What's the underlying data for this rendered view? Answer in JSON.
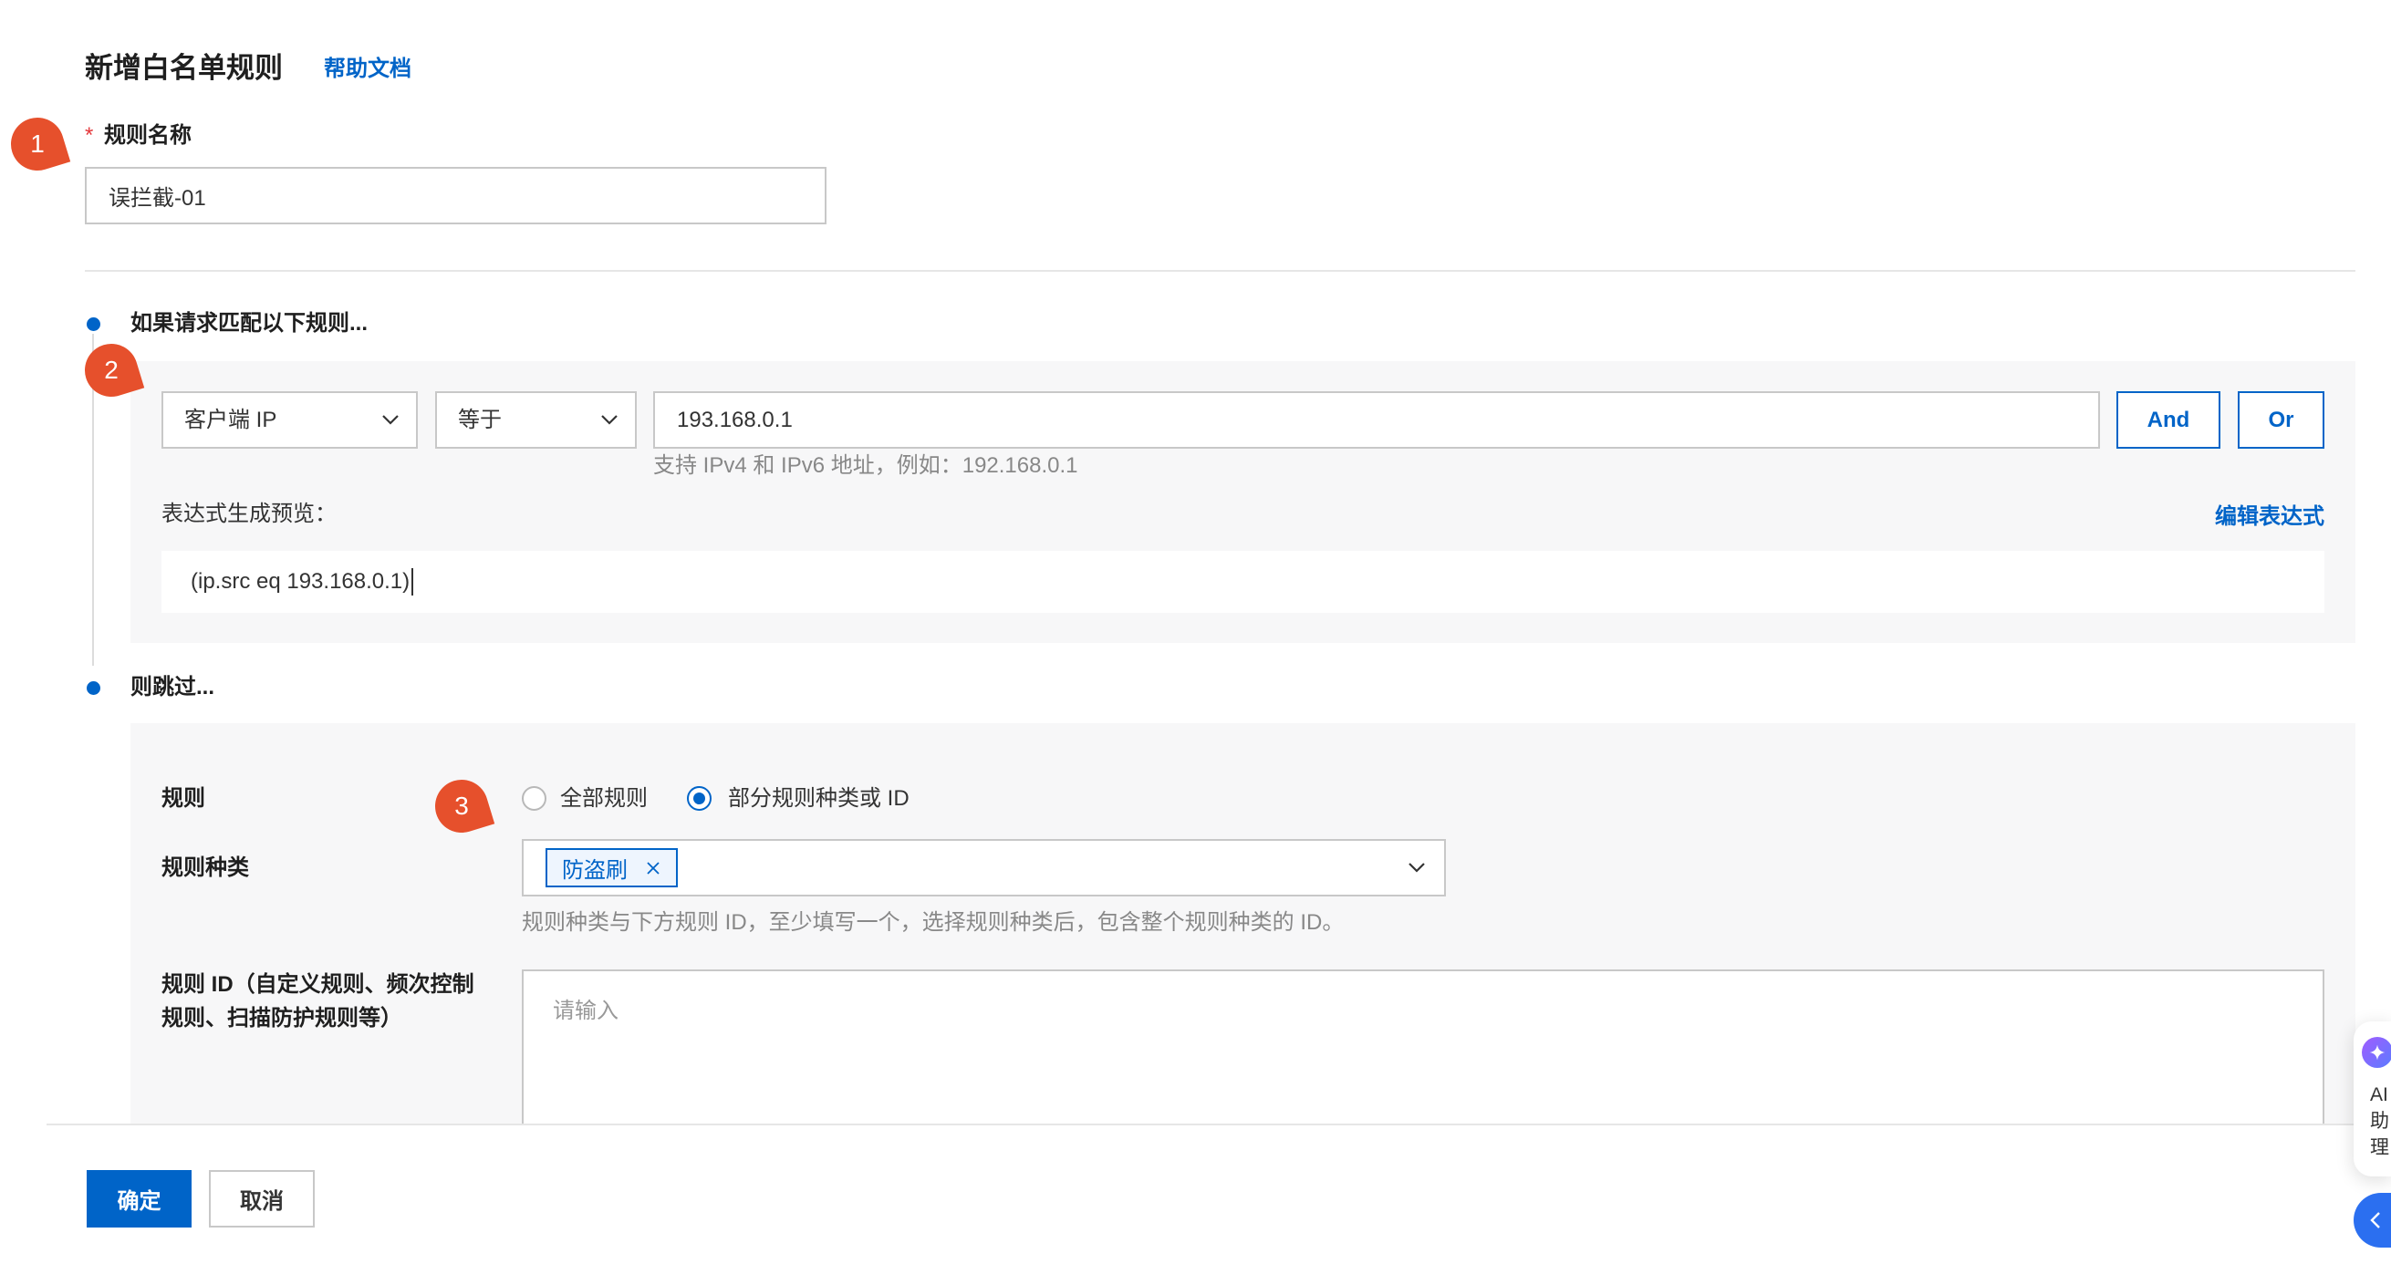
{
  "page": {
    "title": "新增白名单规则",
    "help_link": "帮助文档"
  },
  "annotation_markers": [
    "1",
    "2",
    "3"
  ],
  "rule_name": {
    "required_mark": "*",
    "label": "规则名称",
    "value": "误拦截-01"
  },
  "match_section": {
    "heading": "如果请求匹配以下规则...",
    "condition": {
      "field": "客户端 IP",
      "operator": "等于",
      "value": "193.168.0.1",
      "and_button": "And",
      "or_button": "Or",
      "hint": "支持 IPv4 和 IPv6 地址，例如：192.168.0.1"
    },
    "preview_label": "表达式生成预览：",
    "edit_expression_link": "编辑表达式",
    "expression": "(ip.src eq 193.168.0.1)"
  },
  "skip_section": {
    "heading": "则跳过...",
    "rules": {
      "label": "规则",
      "options": [
        {
          "label": "全部规则",
          "selected": false
        },
        {
          "label": "部分规则种类或 ID",
          "selected": true
        }
      ]
    },
    "rule_category": {
      "label": "规则种类",
      "selected_tags": [
        "防盗刷"
      ],
      "hint": "规则种类与下方规则 ID，至少填写一个，选择规则种类后，包含整个规则种类的 ID。"
    },
    "rule_ids": {
      "label_lines": [
        "规则 ID（自定义规则、频次控制",
        "规则、扫描防护规则等）"
      ],
      "placeholder": "请输入"
    }
  },
  "footer": {
    "confirm_button": "确定",
    "cancel_button": "取消"
  },
  "ai_assistant": {
    "label_lines": [
      "AI",
      "助",
      "理"
    ],
    "icon": "sparkle-icon",
    "collapse_icon": "chevron-left-icon"
  },
  "icons": {
    "select_arrow": "chevron-down-icon",
    "tag_remove": "close-icon"
  },
  "colors": {
    "primary": "#0064c8",
    "annotation": "#e6502c",
    "required": "#e4393c",
    "panel_background": "#f7f7f8",
    "assistant_button": "#2b6ff0"
  }
}
